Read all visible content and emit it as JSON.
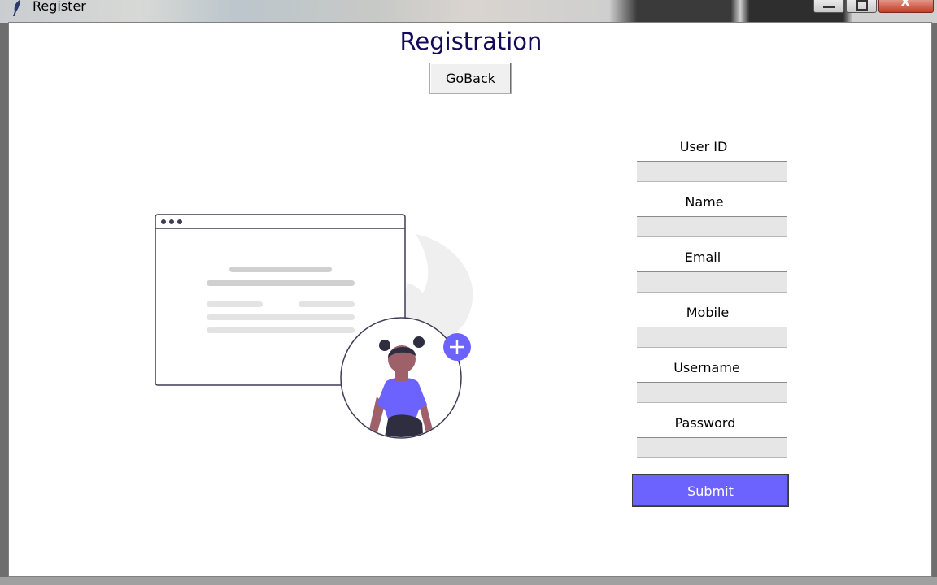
{
  "window": {
    "title": "Register",
    "close_glyph": "X"
  },
  "page": {
    "heading": "Registration",
    "goback_label": "GoBack"
  },
  "form": {
    "fields": [
      {
        "label": "User ID",
        "value": ""
      },
      {
        "label": "Name",
        "value": ""
      },
      {
        "label": "Email",
        "value": ""
      },
      {
        "label": "Mobile",
        "value": ""
      },
      {
        "label": "Username",
        "value": ""
      },
      {
        "label": "Password",
        "value": ""
      }
    ],
    "submit_label": "Submit"
  },
  "colors": {
    "accent": "#6c63ff",
    "heading": "#140a5a",
    "field_bg": "#e6e6e6"
  }
}
